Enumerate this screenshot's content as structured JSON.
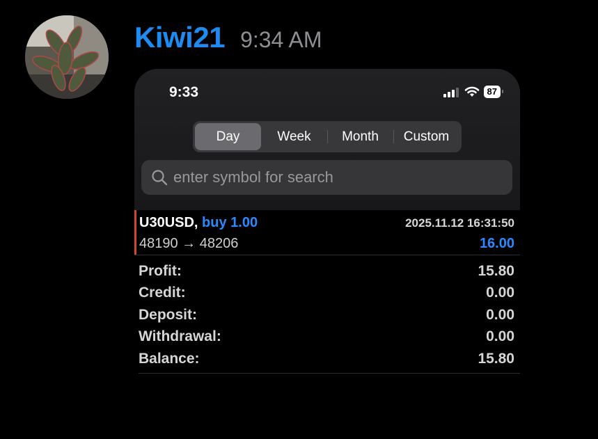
{
  "message": {
    "username": "Kiwi21",
    "time": "9:34 AM"
  },
  "phone": {
    "status_time": "9:33",
    "battery": "87",
    "tabs": [
      {
        "label": "Day",
        "active": true
      },
      {
        "label": "Week",
        "active": false
      },
      {
        "label": "Month",
        "active": false
      },
      {
        "label": "Custom",
        "active": false
      }
    ],
    "search": {
      "placeholder": "enter symbol for search"
    },
    "trade": {
      "symbol": "U30USD,",
      "side": "buy 1.00",
      "datetime": "2025.11.12 16:31:50",
      "prices": "48190 → 48206",
      "profit": "16.00"
    },
    "summary": [
      {
        "label": "Profit:",
        "value": "15.80"
      },
      {
        "label": "Credit:",
        "value": "0.00"
      },
      {
        "label": "Deposit:",
        "value": "0.00"
      },
      {
        "label": "Withdrawal:",
        "value": "0.00"
      },
      {
        "label": "Balance:",
        "value": "15.80"
      }
    ]
  },
  "colors": {
    "username": "#1d8bf0",
    "buy": "#2a8aff",
    "trade_marker": "#d0473a"
  },
  "icons": [
    "avatar-plant-photo",
    "signal-icon",
    "wifi-icon",
    "battery-icon",
    "search-icon"
  ]
}
